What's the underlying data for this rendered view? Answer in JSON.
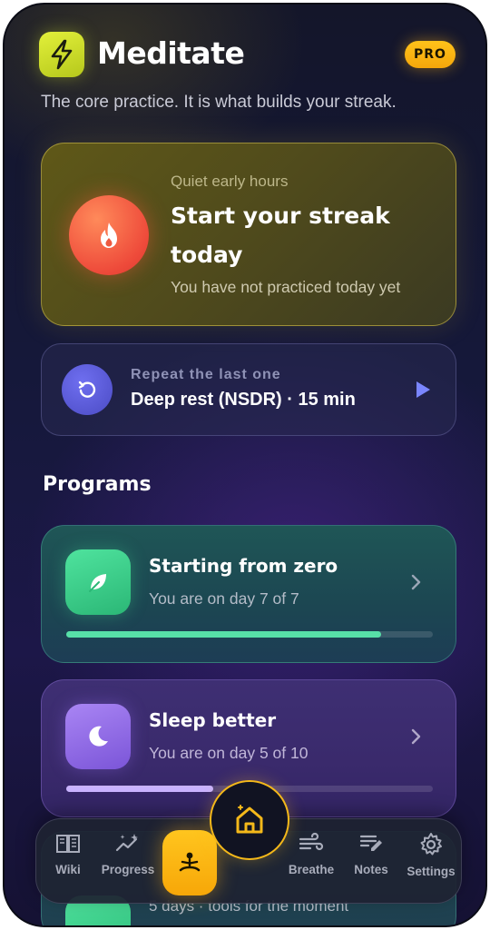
{
  "header": {
    "title": "Meditate",
    "badge": "PRO",
    "subtitle": "The core practice. It is what builds your streak.",
    "logo_icon": "lightning-bolt-icon"
  },
  "streak_card": {
    "eyebrow": "Quiet early hours",
    "title": "Start your streak today",
    "subtitle": "You have not practiced today yet",
    "icon": "flame-icon"
  },
  "repeat_card": {
    "eyebrow": "Repeat the last one",
    "title": "Deep rest (NSDR) · 15 min",
    "icon": "replay-icon",
    "action_icon": "play-icon"
  },
  "programs": {
    "heading": "Programs",
    "items": [
      {
        "title": "Starting from zero",
        "subtitle": "You are on day 7 of 7",
        "icon": "leaf-icon",
        "progress": 0.86
      },
      {
        "title": "Sleep better",
        "subtitle": "You are on day 5 of 10",
        "icon": "moon-icon",
        "progress": 0.4
      },
      {
        "title": "",
        "subtitle": "5 days · tools for the moment",
        "icon": ""
      }
    ]
  },
  "bottom_nav": {
    "items": [
      {
        "label": "Wiki",
        "icon": "book-icon"
      },
      {
        "label": "Progress",
        "icon": "sparkle-chart-icon"
      },
      {
        "label": "",
        "icon": "meditation-icon",
        "active": true
      },
      {
        "label": "Breathe",
        "icon": "wind-icon"
      },
      {
        "label": "Notes",
        "icon": "notes-pencil-icon"
      },
      {
        "label": "Settings",
        "icon": "gear-icon"
      }
    ],
    "home_icon": "home-icon"
  },
  "colors": {
    "accent": "#f7b414",
    "logo": "#d6e62a",
    "streak_flame": "#ee4a3a",
    "repeat": "#5a5ad8",
    "program_green": "#57e0a8",
    "program_purple": "#a985f4"
  }
}
